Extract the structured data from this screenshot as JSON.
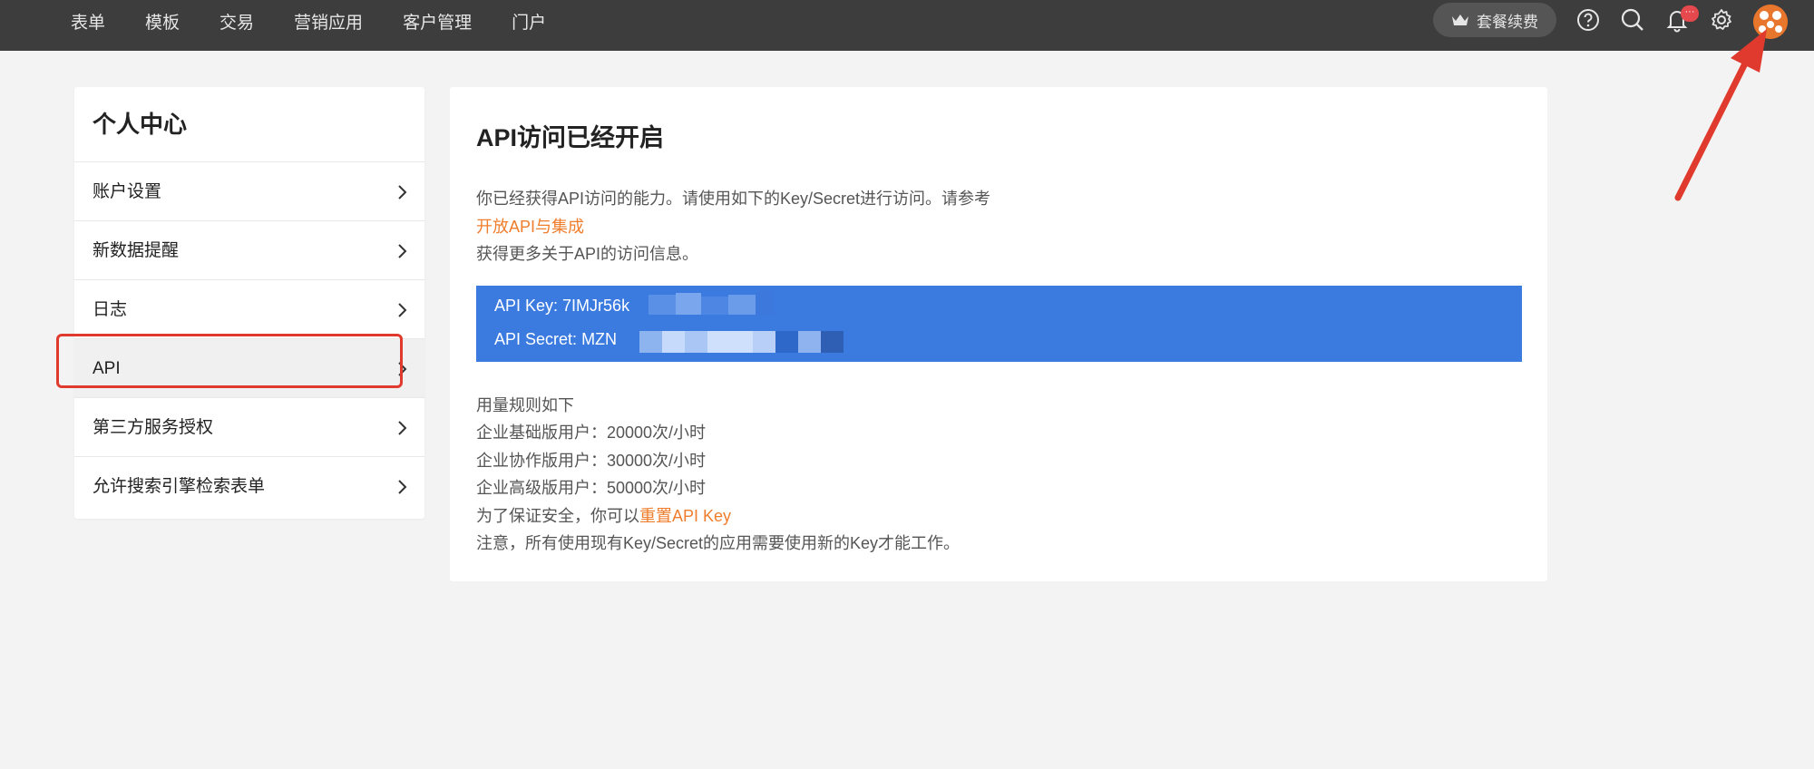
{
  "nav": {
    "items": [
      "表单",
      "模板",
      "交易",
      "营销应用",
      "客户管理",
      "门户"
    ]
  },
  "topbar": {
    "renew_label": "套餐续费",
    "badge_text": "···",
    "icons": [
      "help-icon",
      "search-icon",
      "bell-icon",
      "gear-icon"
    ]
  },
  "sidebar": {
    "title": "个人中心",
    "items": [
      {
        "label": "账户设置"
      },
      {
        "label": "新数据提醒"
      },
      {
        "label": "日志"
      },
      {
        "label": "API",
        "active": true
      },
      {
        "label": "第三方服务授权"
      },
      {
        "label": "允许搜索引擎检索表单"
      }
    ]
  },
  "main": {
    "title": "API访问已经开启",
    "intro_line1": "你已经获得API访问的能力。请使用如下的Key/Secret进行访问。请参考",
    "intro_link": "开放API与集成",
    "intro_line3": "获得更多关于API的访问信息。",
    "api_key_label": "API Key:",
    "api_key_value": "7IMJr56k",
    "api_secret_label": "API Secret:",
    "api_secret_value": "MZN",
    "usage_title": "用量规则如下",
    "usage": [
      "企业基础版用户：20000次/小时",
      "企业协作版用户：30000次/小时",
      "企业高级版用户：50000次/小时"
    ],
    "reset_prefix": "为了保证安全，你可以",
    "reset_link": "重置API Key",
    "notice": "注意，所有使用现有Key/Secret的应用需要使用新的Key才能工作。"
  },
  "colors": {
    "topbar": "#3d3d3d",
    "accent_link": "#ef7d2c",
    "key_box": "#3b7be0",
    "highlight": "#e03a2e"
  }
}
